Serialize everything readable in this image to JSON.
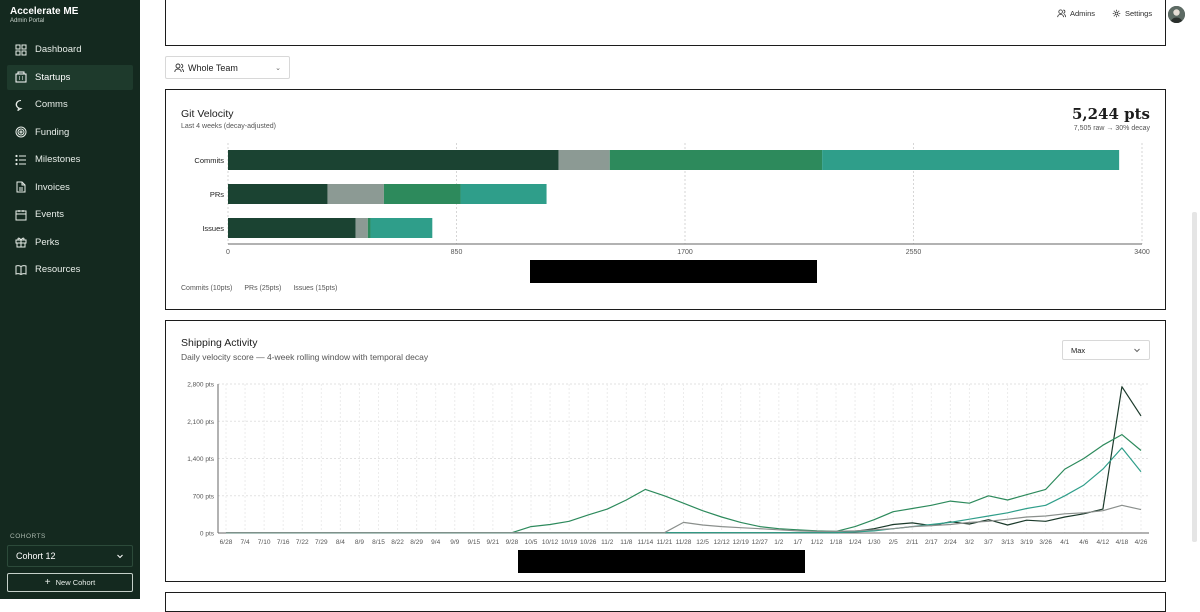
{
  "brand": {
    "title": "Accelerate ME",
    "subtitle": "Admin Portal"
  },
  "nav": [
    {
      "label": "Dashboard",
      "icon": "grid-icon",
      "active": false
    },
    {
      "label": "Startups",
      "icon": "building-icon",
      "active": true
    },
    {
      "label": "Comms",
      "icon": "chat-icon",
      "active": false
    },
    {
      "label": "Funding",
      "icon": "target-icon",
      "active": false
    },
    {
      "label": "Milestones",
      "icon": "list-icon",
      "active": false
    },
    {
      "label": "Invoices",
      "icon": "document-icon",
      "active": false
    },
    {
      "label": "Events",
      "icon": "calendar-icon",
      "active": false
    },
    {
      "label": "Perks",
      "icon": "gift-icon",
      "active": false
    },
    {
      "label": "Resources",
      "icon": "book-icon",
      "active": false
    }
  ],
  "cohorts": {
    "label": "COHORTS",
    "selected": "Cohort 12",
    "new_label": "New Cohort"
  },
  "topbar": {
    "admins": "Admins",
    "settings": "Settings"
  },
  "team_filter": {
    "value": "Whole Team"
  },
  "git_velocity": {
    "title": "Git Velocity",
    "subtitle": "Last 4 weeks (decay-adjusted)",
    "total": "5,244 pts",
    "total_sub": "7,505 raw → 30% decay",
    "legend": [
      "Commits (10pts)",
      "PRs (25pts)",
      "Issues (15pts)"
    ],
    "colors": [
      "#1b4332",
      "#8c9a94",
      "#2d8a5c",
      "#2f9e8a"
    ]
  },
  "shipping": {
    "title": "Shipping Activity",
    "subtitle": "Daily velocity score — 4-week rolling window with temporal decay",
    "range": "Max"
  },
  "chart_data": [
    {
      "type": "bar",
      "orientation": "horizontal",
      "stacked": true,
      "categories": [
        "Commits",
        "PRs",
        "Issues"
      ],
      "series": [
        {
          "values": [
            1230,
            370,
            475
          ]
        },
        {
          "values": [
            190,
            210,
            45
          ]
        },
        {
          "values": [
            790,
            285,
            10
          ]
        },
        {
          "values": [
            1105,
            320,
            230
          ]
        }
      ],
      "xlim": [
        0,
        3400
      ],
      "xticks": [
        "0",
        "850",
        "1700",
        "2550",
        "3400"
      ],
      "grid": true
    },
    {
      "type": "line",
      "x": [
        "6/28",
        "7/4",
        "7/10",
        "7/16",
        "7/22",
        "7/29",
        "8/4",
        "8/9",
        "8/15",
        "8/22",
        "8/29",
        "9/4",
        "9/9",
        "9/15",
        "9/21",
        "9/28",
        "10/5",
        "10/12",
        "10/19",
        "10/26",
        "11/2",
        "11/8",
        "11/14",
        "11/21",
        "11/28",
        "12/5",
        "12/12",
        "12/19",
        "12/27",
        "1/2",
        "1/7",
        "1/12",
        "1/18",
        "1/24",
        "1/30",
        "2/5",
        "2/11",
        "2/17",
        "2/24",
        "3/2",
        "3/7",
        "3/13",
        "3/19",
        "3/26",
        "4/1",
        "4/6",
        "4/12",
        "4/18",
        "4/26"
      ],
      "series": [
        {
          "color": "#1b3a2b",
          "values": [
            5,
            5,
            5,
            5,
            5,
            5,
            5,
            5,
            5,
            5,
            5,
            5,
            5,
            5,
            5,
            5,
            5,
            5,
            5,
            5,
            5,
            5,
            5,
            5,
            5,
            5,
            5,
            5,
            5,
            5,
            5,
            5,
            5,
            30,
            80,
            160,
            190,
            140,
            210,
            170,
            250,
            150,
            240,
            220,
            300,
            360,
            450,
            2750,
            2200
          ]
        },
        {
          "color": "#2d8a5c",
          "values": [
            5,
            5,
            5,
            5,
            5,
            5,
            5,
            5,
            5,
            5,
            5,
            5,
            5,
            5,
            5,
            5,
            120,
            160,
            220,
            340,
            450,
            620,
            820,
            700,
            560,
            420,
            300,
            200,
            120,
            80,
            60,
            40,
            30,
            120,
            250,
            400,
            460,
            520,
            600,
            560,
            700,
            620,
            720,
            820,
            1200,
            1400,
            1650,
            1850,
            1550
          ]
        },
        {
          "color": "#2f9e8a",
          "values": [
            5,
            5,
            5,
            5,
            5,
            5,
            5,
            5,
            5,
            5,
            5,
            5,
            5,
            5,
            5,
            5,
            5,
            5,
            5,
            5,
            5,
            5,
            5,
            5,
            5,
            5,
            5,
            5,
            5,
            5,
            5,
            5,
            5,
            20,
            40,
            80,
            120,
            160,
            200,
            260,
            320,
            380,
            460,
            520,
            700,
            900,
            1200,
            1600,
            1150
          ]
        },
        {
          "color": "#8a8f8c",
          "values": [
            5,
            5,
            5,
            5,
            5,
            5,
            5,
            5,
            5,
            5,
            5,
            5,
            5,
            5,
            5,
            5,
            5,
            5,
            5,
            5,
            5,
            5,
            5,
            5,
            200,
            150,
            120,
            100,
            80,
            60,
            40,
            30,
            30,
            40,
            60,
            80,
            120,
            140,
            160,
            200,
            220,
            260,
            300,
            320,
            360,
            380,
            420,
            520,
            440
          ]
        }
      ],
      "ylim": [
        0,
        2800
      ],
      "yticks": [
        "0 pts",
        "700 pts",
        "1,400 pts",
        "2,100 pts",
        "2,800 pts"
      ],
      "grid": true
    }
  ]
}
